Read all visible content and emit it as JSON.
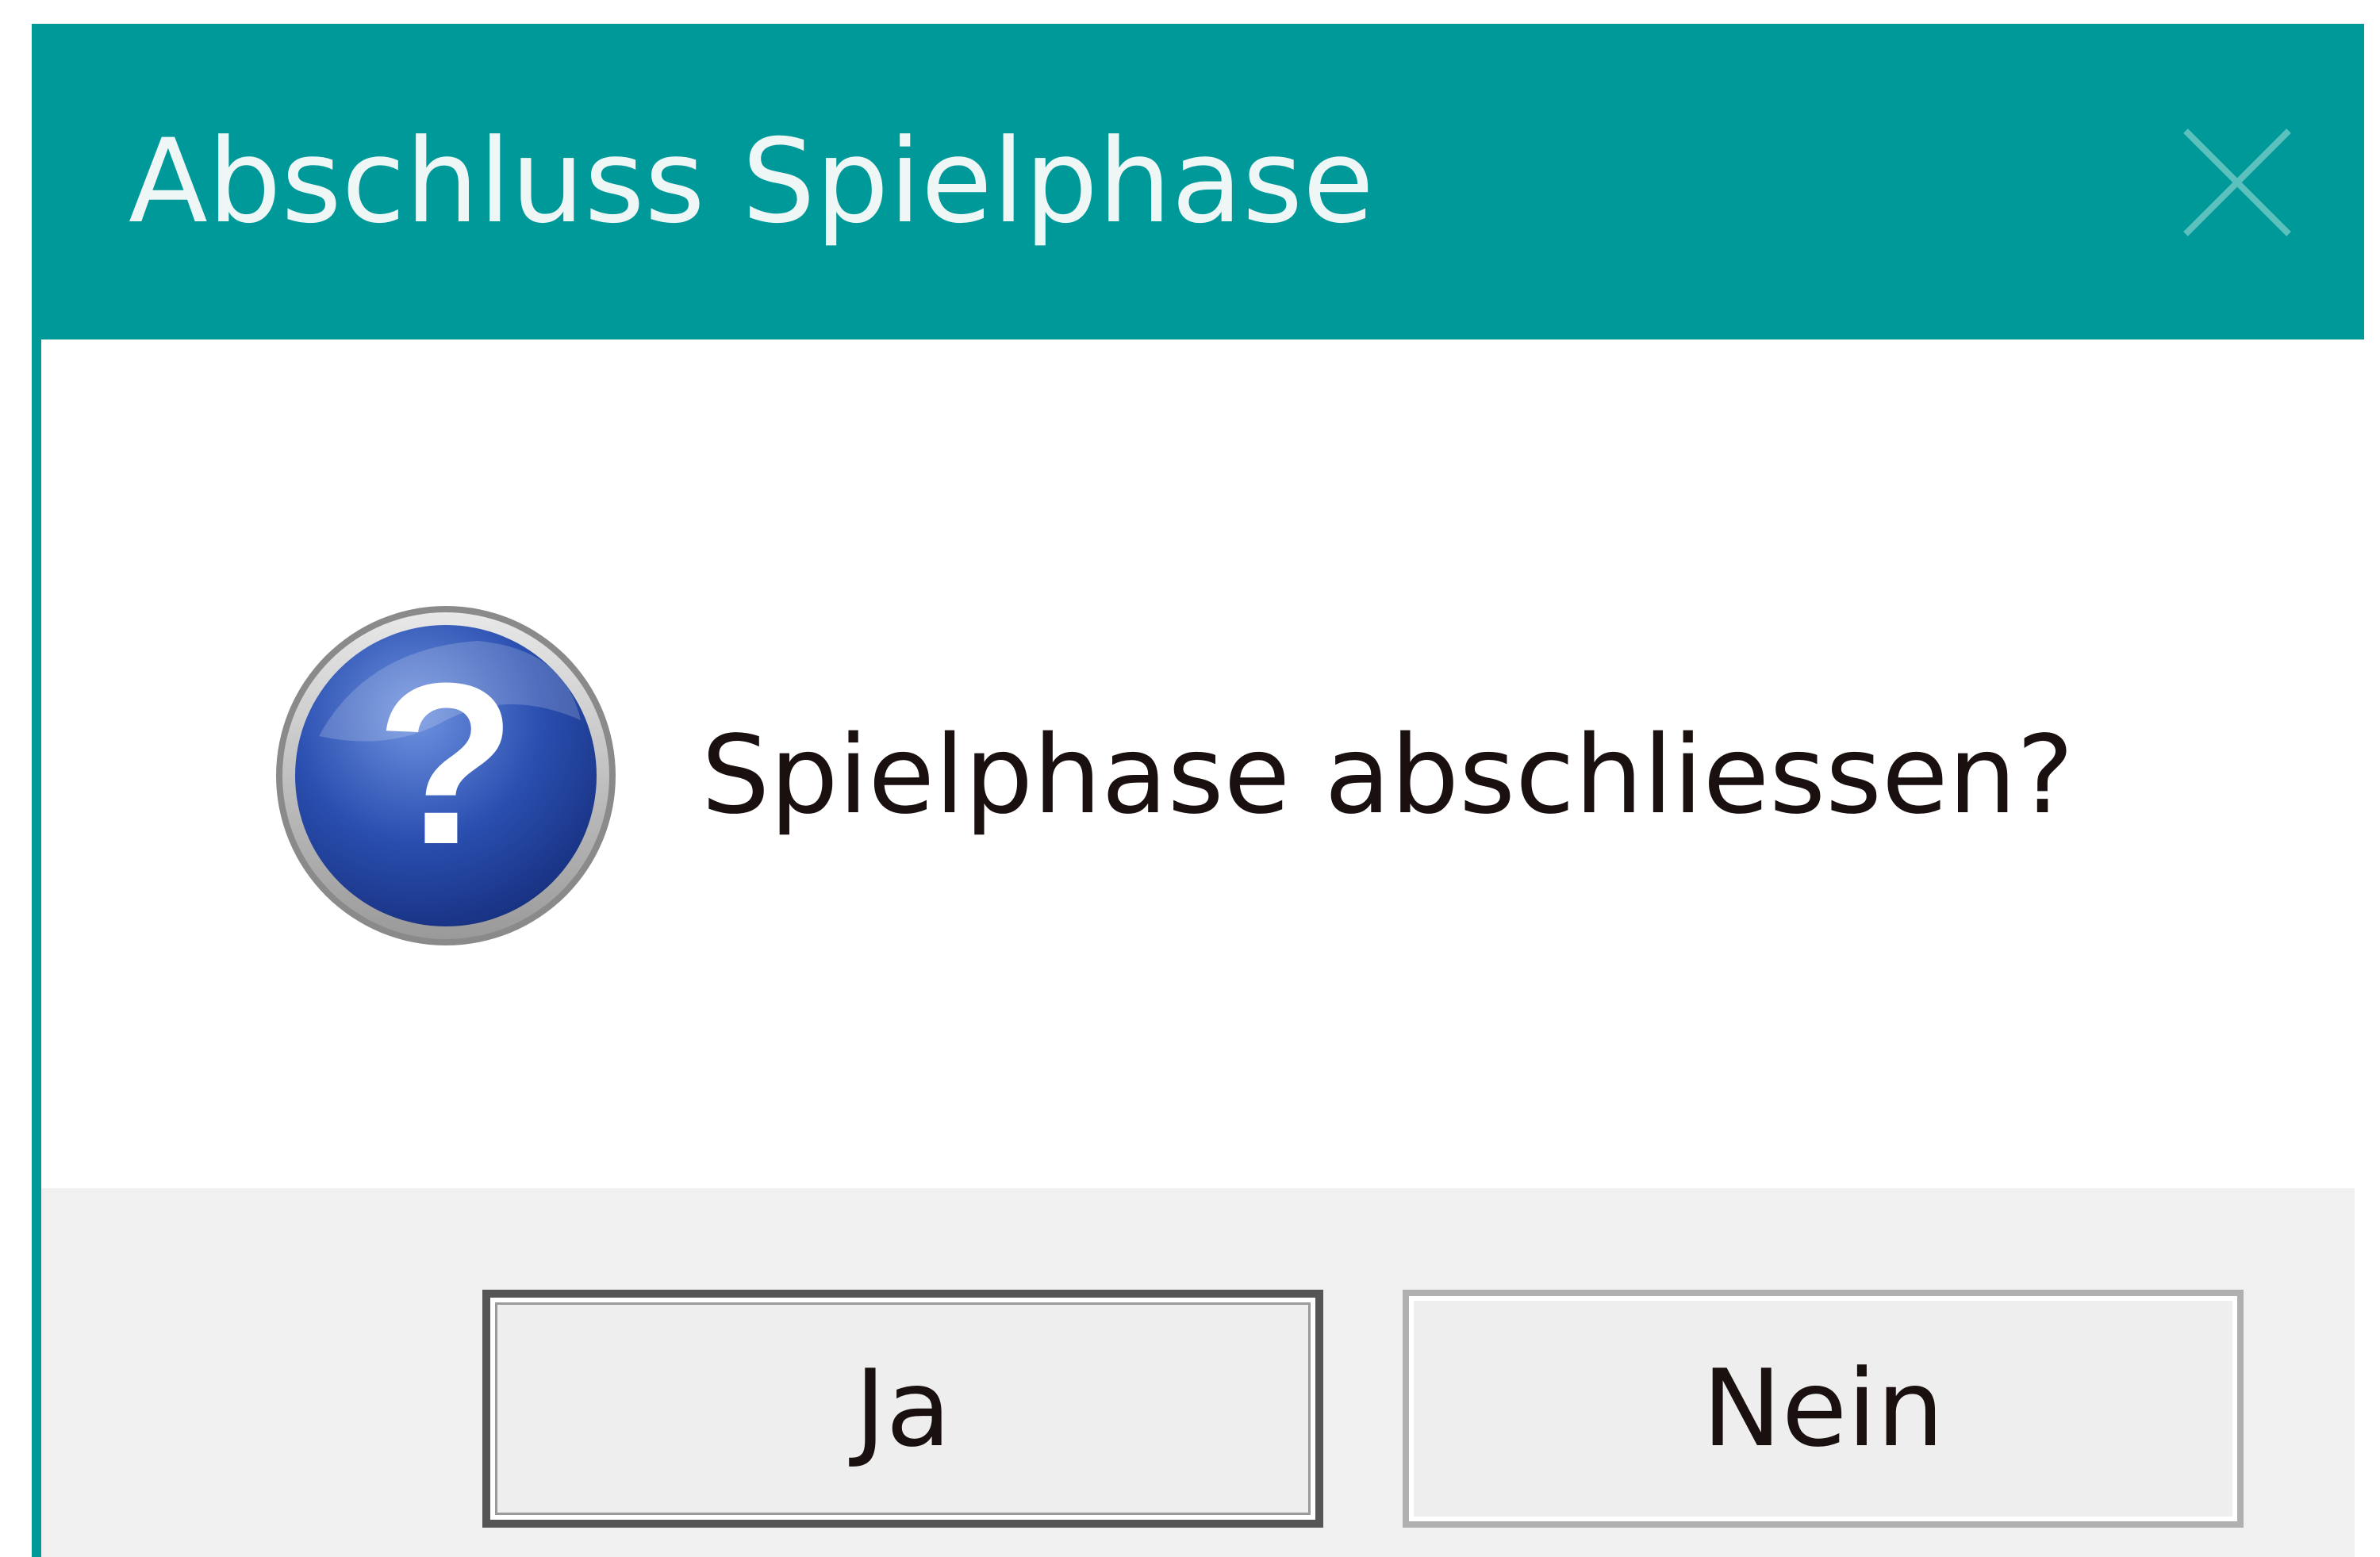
{
  "window": {
    "title": "Abschluss Spielphase",
    "accent_color": "#009999"
  },
  "titlebar": {
    "close_icon": "close-icon"
  },
  "dialog": {
    "icon": "question-icon",
    "message": "Spielphase abschliessen?"
  },
  "buttons": {
    "yes_label": "Ja",
    "no_label": "Nein",
    "default": "Ja"
  }
}
